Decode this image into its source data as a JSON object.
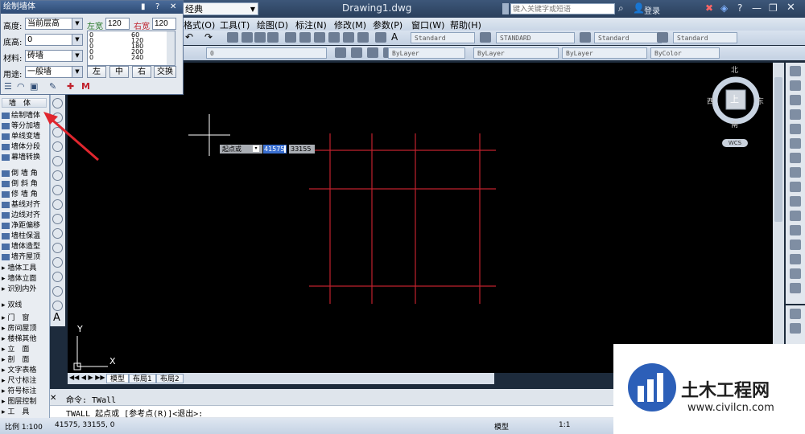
{
  "window": {
    "title": "Drawing1.dwg"
  },
  "workspace": {
    "value": "经典"
  },
  "search": {
    "placeholder": "键入关键字或短语"
  },
  "account": {
    "login": "登录"
  },
  "menu": [
    "格式(O)",
    "工具(T)",
    "绘图(D)",
    "标注(N)",
    "修改(M)",
    "参数(P)",
    "窗口(W)",
    "帮助(H)"
  ],
  "styles": {
    "text": "Standard",
    "dim": "STANDARD",
    "table": "Standard",
    "mleader": "Standard"
  },
  "layer": {
    "current": "0",
    "color": "ByLayer",
    "linetype": "ByLayer",
    "lineweight": "ByLayer",
    "plot": "ByColor"
  },
  "dialog": {
    "title": "绘制墙体",
    "height_label": "高度:",
    "height_value": "当前层高",
    "left_width_label": "左宽",
    "left_width_value": "120",
    "right_width_label": "右宽",
    "right_width_value": "120",
    "base_label": "底高:",
    "base_value": "0",
    "material_label": "材料:",
    "material_value": "砖墙",
    "use_label": "用途:",
    "use_value": "一般墙",
    "list_left": [
      "0",
      "0",
      "0",
      "0",
      "0"
    ],
    "list_right": [
      "60",
      "120",
      "180",
      "200",
      "240"
    ],
    "btn_left": "左",
    "btn_center": "中",
    "btn_right": "右",
    "btn_swap": "交换"
  },
  "palette": {
    "header": "墙　体",
    "items": [
      "绘制墙体",
      "等分加墙",
      "单线变墙",
      "墙体分段",
      "幕墙转换",
      "倒 墙 角",
      "倒 斜 角",
      "修 墙 角",
      "基线对齐",
      "边线对齐",
      "净距偏移",
      "墙柱保温",
      "墙体造型",
      "墙齐屋顶",
      "墙体工具",
      "墙体立面",
      "识别内外"
    ],
    "sections": [
      "双线",
      "门　窗",
      "房间屋顶",
      "楼梯其他",
      "立　面",
      "剖　面",
      "文字表格",
      "尺寸标注",
      "符号标注",
      "图层控制",
      "工　具"
    ]
  },
  "compass": {
    "north": "北",
    "south": "南",
    "east": "东",
    "west": "西",
    "top": "上",
    "wcs": "WCS"
  },
  "axis": {
    "y": "Y",
    "x": "X"
  },
  "dynamic_input": {
    "prompt": "起点或",
    "x": "41575",
    "y": "33155"
  },
  "tabs": [
    "模型",
    "布局1",
    "布局2"
  ],
  "command": {
    "history": "命令: TWall",
    "current": "TWALL 起点或 [参考点(R)]<退出>:"
  },
  "status": {
    "scale": "比例 1:100",
    "coords": "41575, 33155, 0",
    "model": "模型",
    "annoscale": "1:1"
  },
  "watermark": {
    "brand": "土木工程网",
    "url": "www.civilcn.com"
  },
  "colors": {
    "grid_line": "#c0222d",
    "canvas_bg": "#000000",
    "accent": "#2d4a73"
  }
}
